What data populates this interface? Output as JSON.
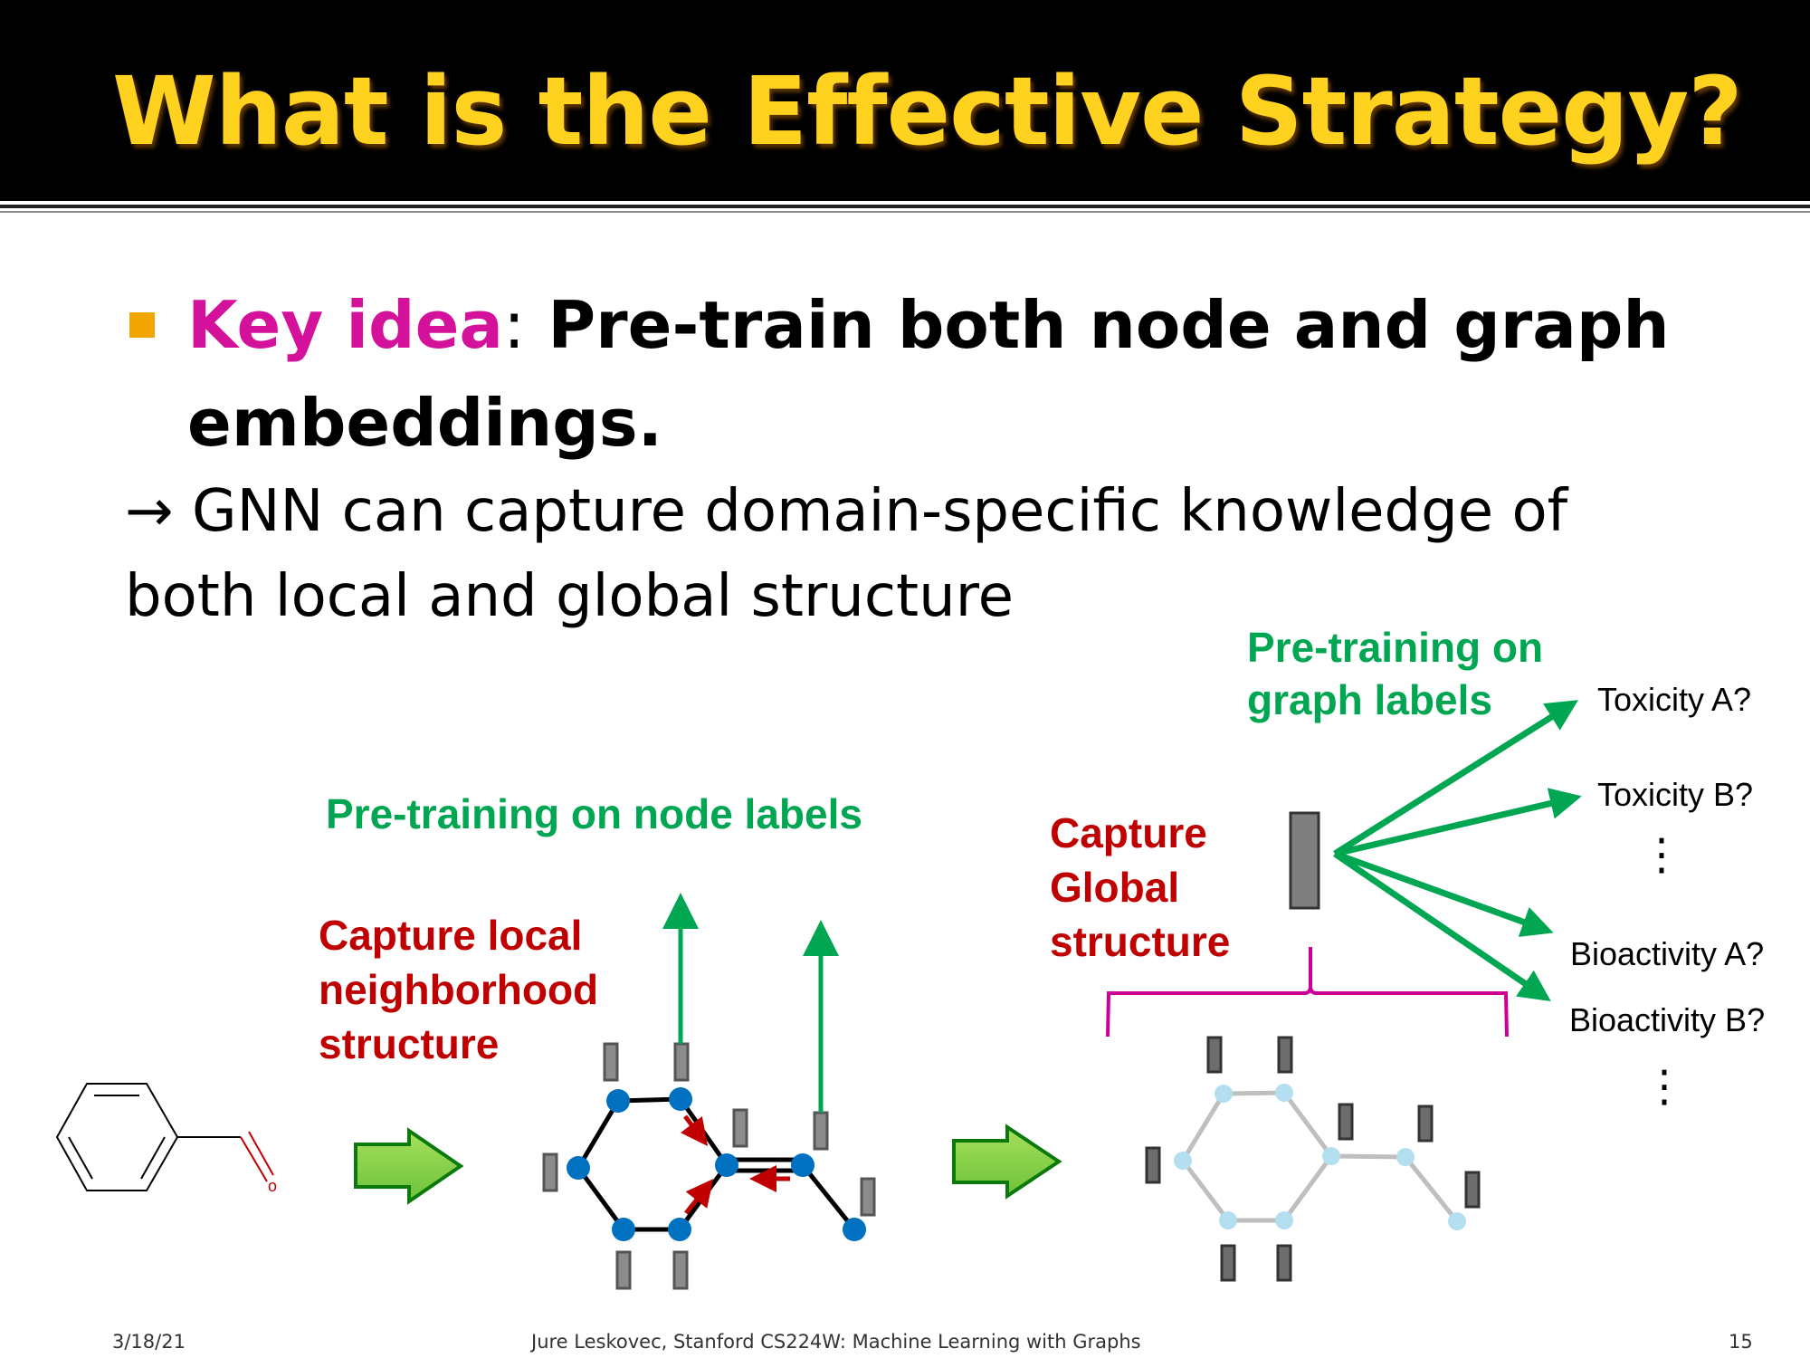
{
  "slide": {
    "title": "What is the Effective Strategy?",
    "bullet": {
      "key_label": "Key idea",
      "colon": ":",
      "text": " Pre-train both node and graph embeddings."
    },
    "subtext": {
      "arrow": "→",
      "text": " GNN can capture domain-specific knowledge of both local and global structure"
    }
  },
  "diagram": {
    "node_label_heading": "Pre-training on node labels",
    "local_caption": [
      "Capture local",
      "neighborhood",
      "structure"
    ],
    "global_caption": [
      "Capture",
      "Global",
      "structure"
    ],
    "graph_label_heading": [
      "Pre-training on",
      "graph labels"
    ],
    "molecule_atom": "o",
    "tasks": [
      "Toxicity A?",
      "Toxicity B?",
      "Bioactivity A?",
      "Bioactivity B?"
    ],
    "ellipsis": "⋮",
    "colors": {
      "green": "#00a651",
      "red": "#c00000",
      "magenta": "#cc0099",
      "node_blue": "#0070c0",
      "node_light": "#b3dff0",
      "embedding_gray": "#808080"
    }
  },
  "footer": {
    "date": "3/18/21",
    "course": "Jure Leskovec, Stanford CS224W: Machine Learning with Graphs",
    "page": "15"
  }
}
